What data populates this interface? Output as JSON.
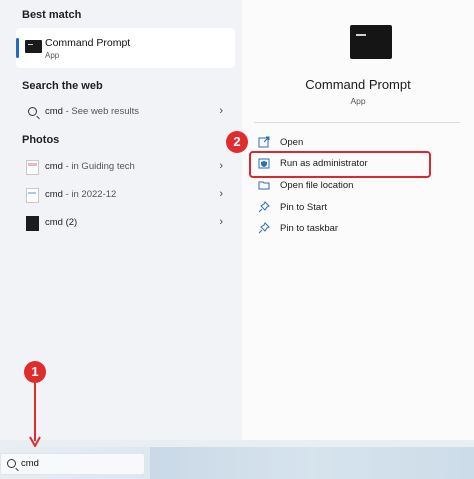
{
  "best_match": {
    "header": "Best match",
    "title": "Command Prompt",
    "subtitle": "App"
  },
  "search_web": {
    "header": "Search the web",
    "query": "cmd",
    "suffix": " - See web results"
  },
  "photos": {
    "header": "Photos",
    "items": [
      {
        "name": "cmd",
        "detail": " - in Guiding tech",
        "thumb": "pink"
      },
      {
        "name": "cmd",
        "detail": " - in 2022-12",
        "thumb": "light"
      },
      {
        "name": "cmd (2)",
        "detail": "",
        "thumb": "dark"
      }
    ]
  },
  "detail": {
    "title": "Command Prompt",
    "subtitle": "App",
    "actions": [
      {
        "label": "Open",
        "icon": "open-icon"
      },
      {
        "label": "Run as administrator",
        "icon": "shield-icon"
      },
      {
        "label": "Open file location",
        "icon": "folder-icon"
      },
      {
        "label": "Pin to Start",
        "icon": "pin-icon"
      },
      {
        "label": "Pin to taskbar",
        "icon": "pin-icon"
      }
    ]
  },
  "annotations": {
    "step1": "1",
    "step2": "2",
    "accent_color": "#d9282f"
  },
  "taskbar": {
    "search_value": "cmd"
  }
}
